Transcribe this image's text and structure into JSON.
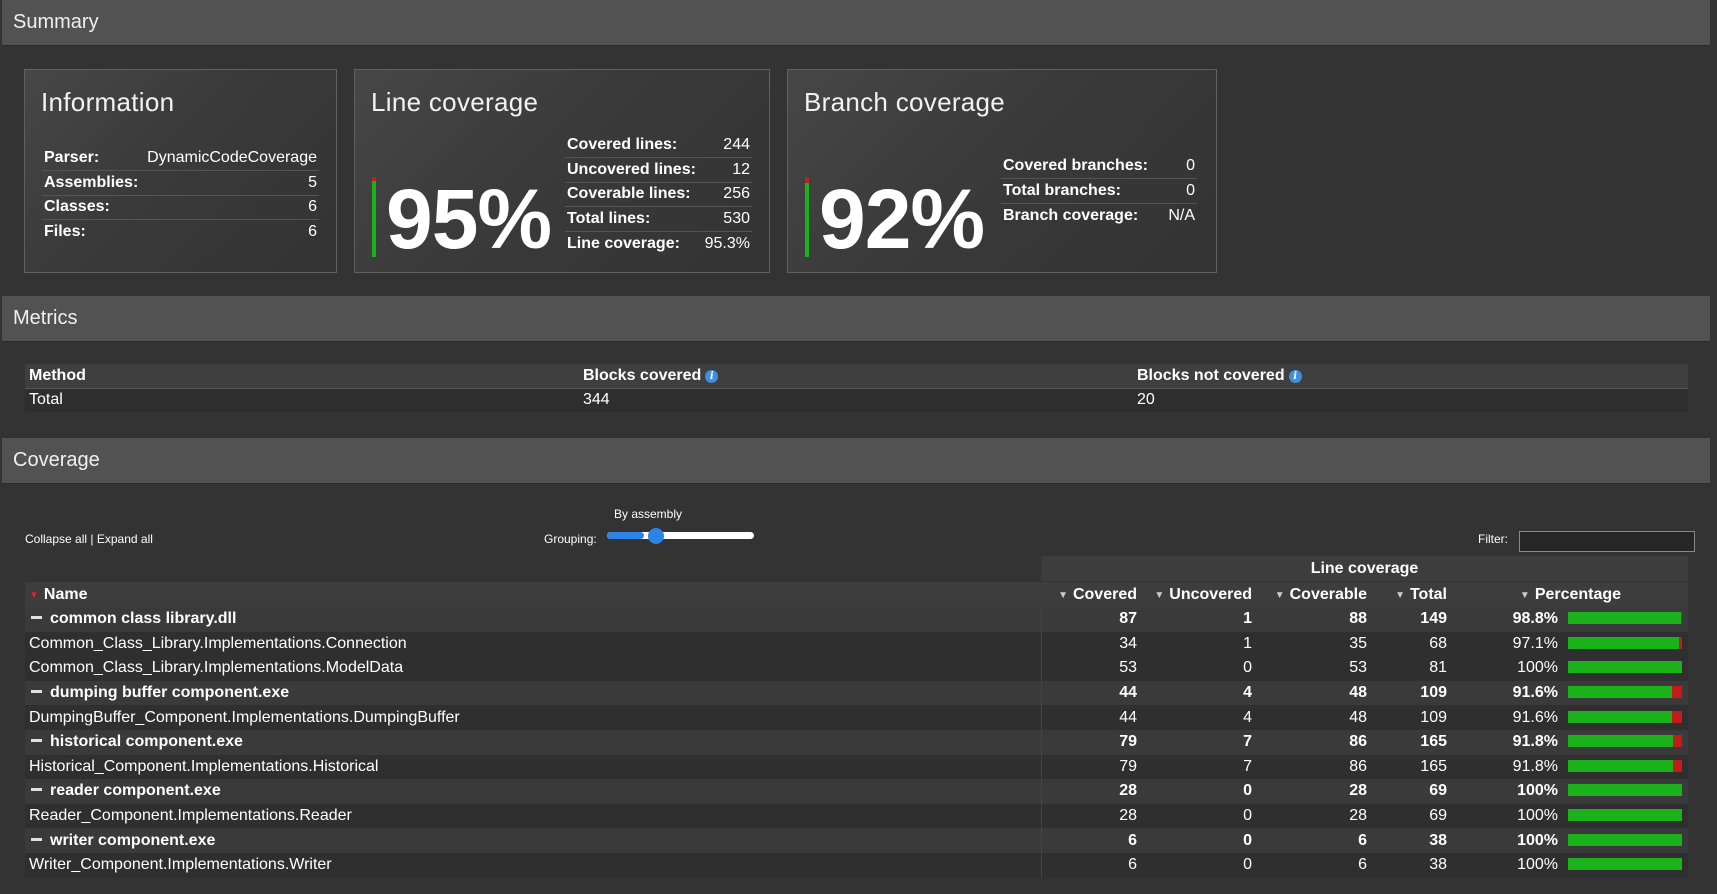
{
  "sections": {
    "summary": "Summary",
    "metrics": "Metrics",
    "coverage": "Coverage"
  },
  "information": {
    "title": "Information",
    "rows": [
      {
        "label": "Parser:",
        "value": "DynamicCodeCoverage"
      },
      {
        "label": "Assemblies:",
        "value": "5"
      },
      {
        "label": "Classes:",
        "value": "6"
      },
      {
        "label": "Files:",
        "value": "6"
      }
    ]
  },
  "line_coverage": {
    "title": "Line coverage",
    "big": "95%",
    "percent": 95.3,
    "rows": [
      {
        "label": "Covered lines:",
        "value": "244"
      },
      {
        "label": "Uncovered lines:",
        "value": "12"
      },
      {
        "label": "Coverable lines:",
        "value": "256"
      },
      {
        "label": "Total lines:",
        "value": "530"
      },
      {
        "label": "Line coverage:",
        "value": "95.3%"
      }
    ]
  },
  "branch_coverage": {
    "title": "Branch coverage",
    "big": "92%",
    "percent": 92,
    "rows": [
      {
        "label": "Covered branches:",
        "value": "0"
      },
      {
        "label": "Total branches:",
        "value": "0"
      },
      {
        "label": "Branch coverage:",
        "value": "N/A"
      }
    ]
  },
  "metrics": {
    "headers": [
      "Method",
      "Blocks covered",
      "Blocks not covered"
    ],
    "row": [
      "Total",
      "344",
      "20"
    ]
  },
  "controls": {
    "collapse_all": "Collapse all",
    "separator": "|",
    "expand_all": "Expand all",
    "grouping_label": "Grouping:",
    "grouping_value": "By assembly",
    "grouping_level": 0.25,
    "filter_label": "Filter:",
    "filter_value": ""
  },
  "coverage_table": {
    "group_header": "Line coverage",
    "columns": [
      "Name",
      "Covered",
      "Uncovered",
      "Coverable",
      "Total",
      "Percentage"
    ],
    "rows": [
      {
        "type": "group",
        "name": "common class library.dll",
        "covered": "87",
        "uncovered": "1",
        "coverable": "88",
        "total": "149",
        "percentage": "98.8%",
        "pct": 98.8
      },
      {
        "type": "class",
        "name": "Common_Class_Library.Implementations.Connection",
        "covered": "34",
        "uncovered": "1",
        "coverable": "35",
        "total": "68",
        "percentage": "97.1%",
        "pct": 97.1
      },
      {
        "type": "class",
        "name": "Common_Class_Library.Implementations.ModelData",
        "covered": "53",
        "uncovered": "0",
        "coverable": "53",
        "total": "81",
        "percentage": "100%",
        "pct": 100
      },
      {
        "type": "group",
        "name": "dumping buffer component.exe",
        "covered": "44",
        "uncovered": "4",
        "coverable": "48",
        "total": "109",
        "percentage": "91.6%",
        "pct": 91.6
      },
      {
        "type": "class",
        "name": "DumpingBuffer_Component.Implementations.DumpingBuffer",
        "covered": "44",
        "uncovered": "4",
        "coverable": "48",
        "total": "109",
        "percentage": "91.6%",
        "pct": 91.6
      },
      {
        "type": "group",
        "name": "historical component.exe",
        "covered": "79",
        "uncovered": "7",
        "coverable": "86",
        "total": "165",
        "percentage": "91.8%",
        "pct": 91.8
      },
      {
        "type": "class",
        "name": "Historical_Component.Implementations.Historical",
        "covered": "79",
        "uncovered": "7",
        "coverable": "86",
        "total": "165",
        "percentage": "91.8%",
        "pct": 91.8
      },
      {
        "type": "group",
        "name": "reader component.exe",
        "covered": "28",
        "uncovered": "0",
        "coverable": "28",
        "total": "69",
        "percentage": "100%",
        "pct": 100
      },
      {
        "type": "class",
        "name": "Reader_Component.Implementations.Reader",
        "covered": "28",
        "uncovered": "0",
        "coverable": "28",
        "total": "69",
        "percentage": "100%",
        "pct": 100
      },
      {
        "type": "group",
        "name": "writer component.exe",
        "covered": "6",
        "uncovered": "0",
        "coverable": "6",
        "total": "38",
        "percentage": "100%",
        "pct": 100
      },
      {
        "type": "class",
        "name": "Writer_Component.Implementations.Writer",
        "covered": "6",
        "uncovered": "0",
        "coverable": "6",
        "total": "38",
        "percentage": "100%",
        "pct": 100
      }
    ]
  }
}
